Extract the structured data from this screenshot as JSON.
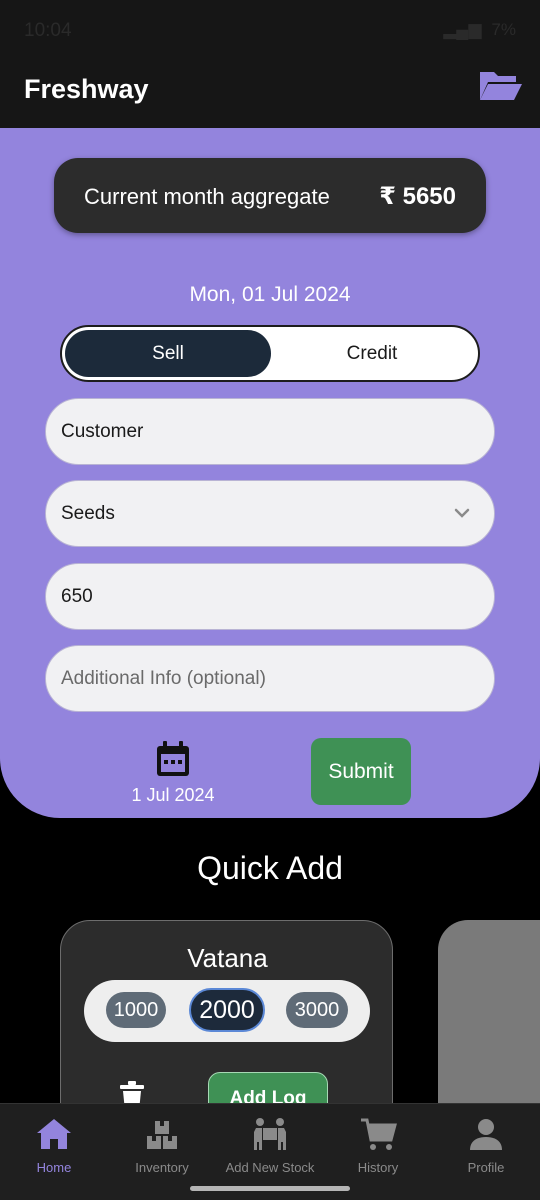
{
  "status": {
    "time": "10:04",
    "battery": "7%"
  },
  "app": {
    "title": "Freshway"
  },
  "aggregate": {
    "label": "Current month aggregate",
    "value": "₹ 5650"
  },
  "form": {
    "date_heading": "Mon, 01 Jul 2024",
    "toggle": {
      "sell": "Sell",
      "credit": "Credit",
      "selected": "Sell"
    },
    "customer_value": "Customer",
    "product_value": "Seeds",
    "amount_value": "650",
    "additional_placeholder": "Additional Info (optional)",
    "picked_date": "1 Jul 2024",
    "submit_label": "Submit"
  },
  "quick_add": {
    "title": "Quick Add",
    "cards": [
      {
        "name": "Vatana",
        "options": [
          "1000",
          "2000",
          "3000"
        ],
        "selected": "2000",
        "add_label": "Add Log"
      }
    ]
  },
  "nav": {
    "items": [
      {
        "label": "Home",
        "icon": "home-icon",
        "active": true
      },
      {
        "label": "Inventory",
        "icon": "inventory-icon",
        "active": false
      },
      {
        "label": "Add New Stock",
        "icon": "add-stock-icon",
        "active": false
      },
      {
        "label": "History",
        "icon": "cart-icon",
        "active": false
      },
      {
        "label": "Profile",
        "icon": "profile-icon",
        "active": false
      }
    ]
  },
  "colors": {
    "accent": "#9384dd",
    "dark_card": "#2c2c2c",
    "success": "#3f9155",
    "toggle_active": "#1c2a3a"
  }
}
